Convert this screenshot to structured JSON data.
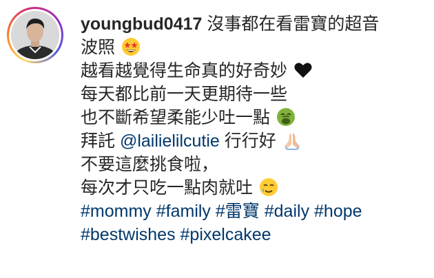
{
  "post": {
    "username": "youngbud0417",
    "caption_lines": [
      " 沒事都在看雷寶的超音",
      "波照",
      "越看越覺得生命真的好奇妙",
      "每天都比前一天更期待一些",
      "也不斷希望柔能少吐一點",
      "拜託 ",
      " 行行好",
      "不要這麼挑食啦，",
      "每次才只吃一點肉就吐"
    ],
    "mention": "@lailielilcutie",
    "hashtags": [
      "#mommy",
      "#family",
      "#雷寶",
      "#daily",
      "#hope",
      "#bestwishes",
      "#pixelcakee"
    ],
    "emojis": [
      "star-struck-emoji",
      "black-heart-emoji",
      "nauseated-emoji",
      "folded-hands-emoji",
      "smiling-tear-emoji"
    ]
  },
  "colors": {
    "text": "#262626",
    "link": "#00376b",
    "ring_start": "#feda75",
    "ring_end": "#d62976"
  }
}
